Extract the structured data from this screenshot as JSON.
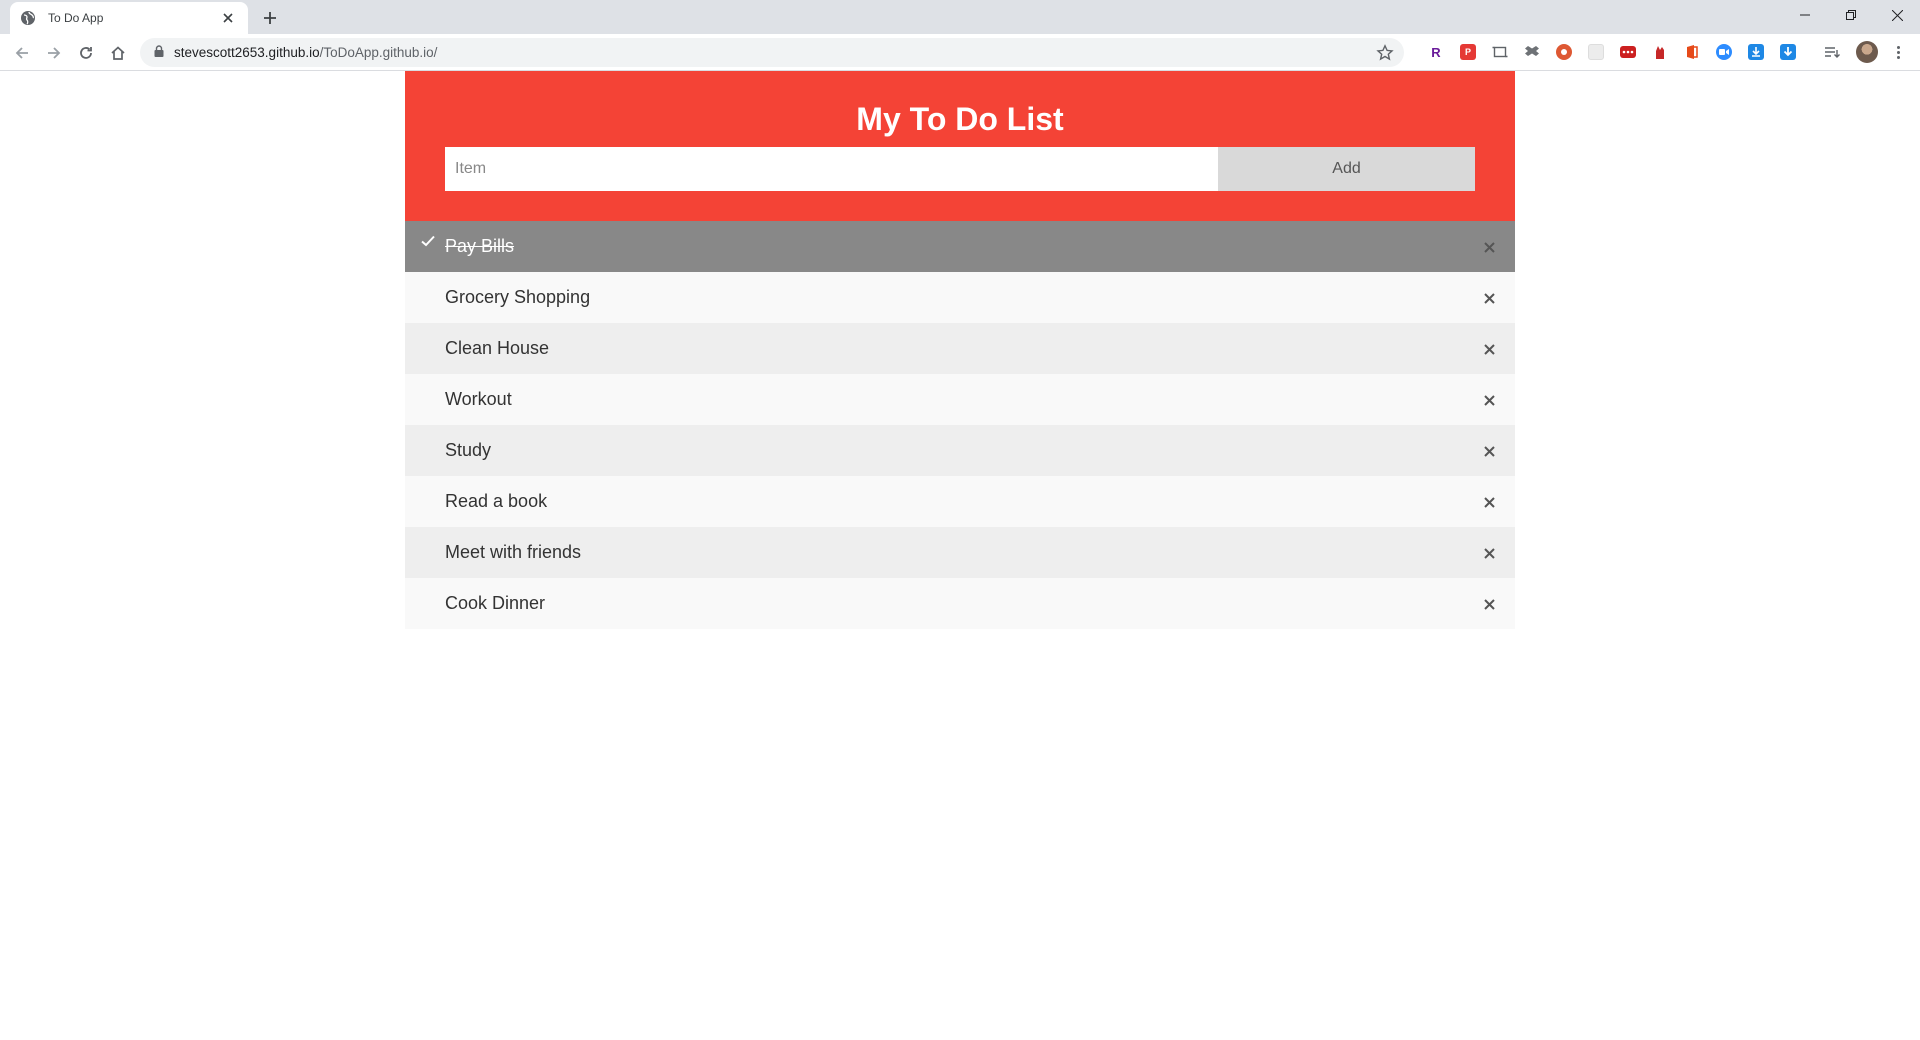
{
  "browser": {
    "tab_title": "To Do App",
    "url_host": "stevescott2653.github.io",
    "url_path": "/ToDoApp.github.io/",
    "extensions": [
      {
        "name": "r-icon",
        "letter": "R",
        "color": "#6a1b9a"
      },
      {
        "name": "p-icon",
        "letter": "P",
        "color": "#e53935"
      },
      {
        "name": "screenshot-icon",
        "letter": "",
        "color": "#ffffff"
      },
      {
        "name": "dropbox-icon",
        "letter": "",
        "color": "#ffffff"
      },
      {
        "name": "duckduckgo-icon",
        "letter": "",
        "color": "#de5833"
      },
      {
        "name": "blank-extension-icon",
        "letter": "",
        "color": "#ececec"
      },
      {
        "name": "lastpass-icon",
        "letter": "",
        "color": "#cc2020"
      },
      {
        "name": "red-hand-icon",
        "letter": "",
        "color": "#c62828"
      },
      {
        "name": "office-icon",
        "letter": "",
        "color": "#e64a19"
      },
      {
        "name": "zoom-icon",
        "letter": "",
        "color": "#2d8cff"
      },
      {
        "name": "download-icon",
        "letter": "",
        "color": "#1e88e5"
      },
      {
        "name": "download-arrow-icon",
        "letter": "",
        "color": "#1e88e5"
      }
    ]
  },
  "app": {
    "title": "My To Do List",
    "input_placeholder": "Item",
    "add_label": "Add",
    "items": [
      {
        "text": "Pay Bills",
        "checked": true
      },
      {
        "text": "Grocery Shopping",
        "checked": false
      },
      {
        "text": "Clean House",
        "checked": false
      },
      {
        "text": "Workout",
        "checked": false
      },
      {
        "text": "Study",
        "checked": false
      },
      {
        "text": "Read a book",
        "checked": false
      },
      {
        "text": "Meet with friends",
        "checked": false
      },
      {
        "text": "Cook Dinner",
        "checked": false
      }
    ]
  }
}
